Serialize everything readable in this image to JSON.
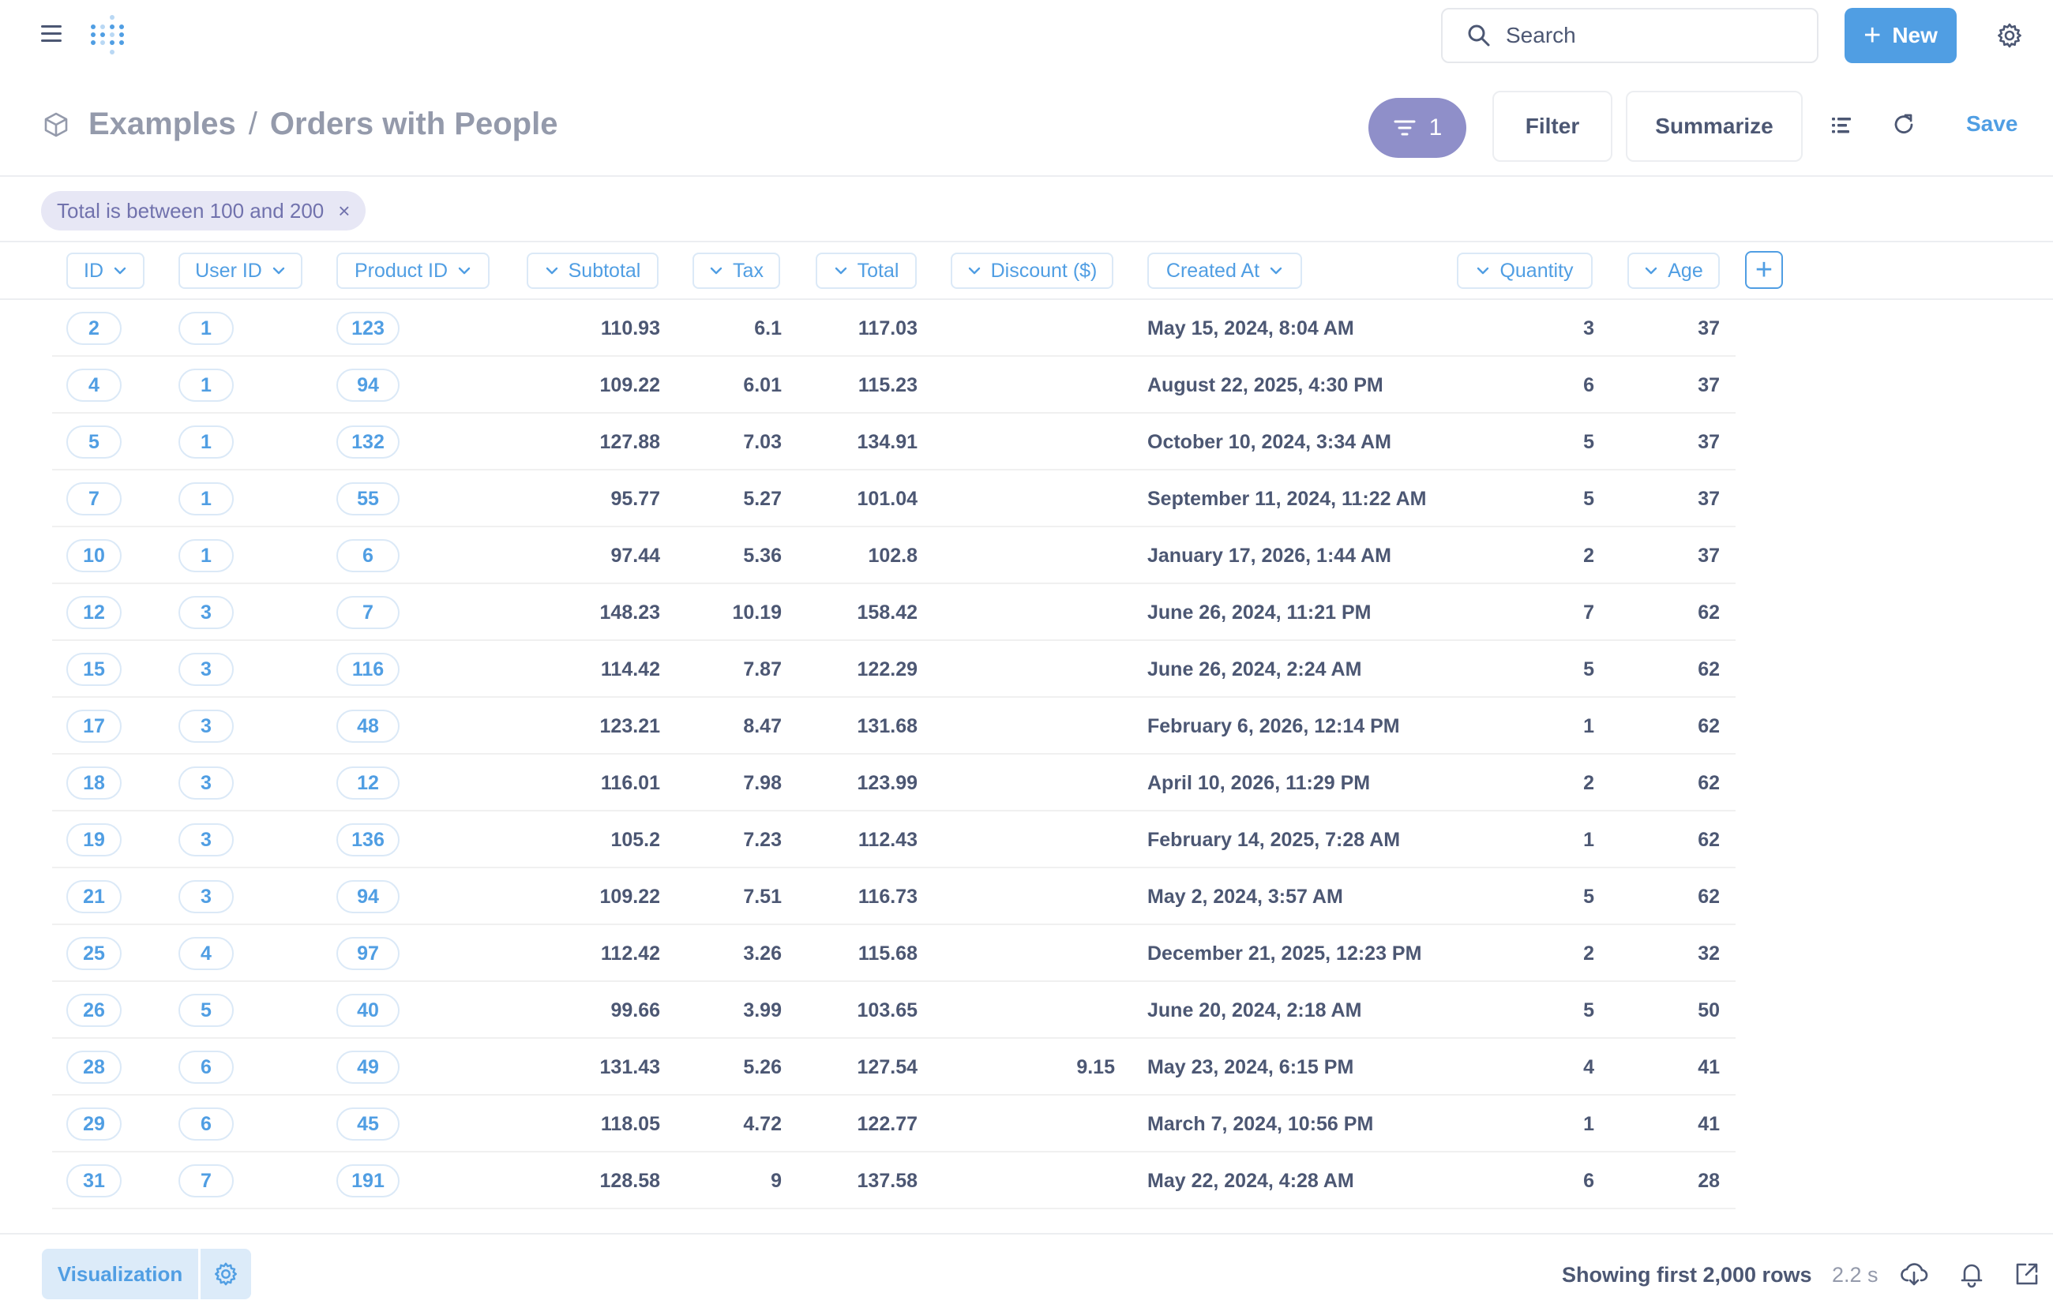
{
  "nav": {
    "search_placeholder": "Search",
    "new_label": "New",
    "new_plus": "+"
  },
  "header": {
    "collection": "Examples",
    "separator": "/",
    "title": "Orders with People",
    "filter_count": "1",
    "filter_label": "Filter",
    "summarize_label": "Summarize",
    "save_label": "Save"
  },
  "active_filter": {
    "label": "Total is between 100 and 200",
    "remove_glyph": "×"
  },
  "columns": [
    {
      "key": "id",
      "label": "ID"
    },
    {
      "key": "user_id",
      "label": "User ID"
    },
    {
      "key": "product_id",
      "label": "Product ID"
    },
    {
      "key": "subtotal",
      "label": "Subtotal"
    },
    {
      "key": "tax",
      "label": "Tax"
    },
    {
      "key": "total",
      "label": "Total"
    },
    {
      "key": "discount",
      "label": "Discount ($)"
    },
    {
      "key": "created_at",
      "label": "Created At"
    },
    {
      "key": "quantity",
      "label": "Quantity"
    },
    {
      "key": "age",
      "label": "Age"
    }
  ],
  "add_column_glyph": "+",
  "rows": [
    {
      "id": "2",
      "user_id": "1",
      "product_id": "123",
      "subtotal": "110.93",
      "tax": "6.1",
      "total": "117.03",
      "discount": "",
      "created_at": "May 15, 2024, 8:04 AM",
      "quantity": "3",
      "age": "37"
    },
    {
      "id": "4",
      "user_id": "1",
      "product_id": "94",
      "subtotal": "109.22",
      "tax": "6.01",
      "total": "115.23",
      "discount": "",
      "created_at": "August 22, 2025, 4:30 PM",
      "quantity": "6",
      "age": "37"
    },
    {
      "id": "5",
      "user_id": "1",
      "product_id": "132",
      "subtotal": "127.88",
      "tax": "7.03",
      "total": "134.91",
      "discount": "",
      "created_at": "October 10, 2024, 3:34 AM",
      "quantity": "5",
      "age": "37"
    },
    {
      "id": "7",
      "user_id": "1",
      "product_id": "55",
      "subtotal": "95.77",
      "tax": "5.27",
      "total": "101.04",
      "discount": "",
      "created_at": "September 11, 2024, 11:22 AM",
      "quantity": "5",
      "age": "37"
    },
    {
      "id": "10",
      "user_id": "1",
      "product_id": "6",
      "subtotal": "97.44",
      "tax": "5.36",
      "total": "102.8",
      "discount": "",
      "created_at": "January 17, 2026, 1:44 AM",
      "quantity": "2",
      "age": "37"
    },
    {
      "id": "12",
      "user_id": "3",
      "product_id": "7",
      "subtotal": "148.23",
      "tax": "10.19",
      "total": "158.42",
      "discount": "",
      "created_at": "June 26, 2024, 11:21 PM",
      "quantity": "7",
      "age": "62"
    },
    {
      "id": "15",
      "user_id": "3",
      "product_id": "116",
      "subtotal": "114.42",
      "tax": "7.87",
      "total": "122.29",
      "discount": "",
      "created_at": "June 26, 2024, 2:24 AM",
      "quantity": "5",
      "age": "62"
    },
    {
      "id": "17",
      "user_id": "3",
      "product_id": "48",
      "subtotal": "123.21",
      "tax": "8.47",
      "total": "131.68",
      "discount": "",
      "created_at": "February 6, 2026, 12:14 PM",
      "quantity": "1",
      "age": "62"
    },
    {
      "id": "18",
      "user_id": "3",
      "product_id": "12",
      "subtotal": "116.01",
      "tax": "7.98",
      "total": "123.99",
      "discount": "",
      "created_at": "April 10, 2026, 11:29 PM",
      "quantity": "2",
      "age": "62"
    },
    {
      "id": "19",
      "user_id": "3",
      "product_id": "136",
      "subtotal": "105.2",
      "tax": "7.23",
      "total": "112.43",
      "discount": "",
      "created_at": "February 14, 2025, 7:28 AM",
      "quantity": "1",
      "age": "62"
    },
    {
      "id": "21",
      "user_id": "3",
      "product_id": "94",
      "subtotal": "109.22",
      "tax": "7.51",
      "total": "116.73",
      "discount": "",
      "created_at": "May 2, 2024, 3:57 AM",
      "quantity": "5",
      "age": "62"
    },
    {
      "id": "25",
      "user_id": "4",
      "product_id": "97",
      "subtotal": "112.42",
      "tax": "3.26",
      "total": "115.68",
      "discount": "",
      "created_at": "December 21, 2025, 12:23 PM",
      "quantity": "2",
      "age": "32"
    },
    {
      "id": "26",
      "user_id": "5",
      "product_id": "40",
      "subtotal": "99.66",
      "tax": "3.99",
      "total": "103.65",
      "discount": "",
      "created_at": "June 20, 2024, 2:18 AM",
      "quantity": "5",
      "age": "50"
    },
    {
      "id": "28",
      "user_id": "6",
      "product_id": "49",
      "subtotal": "131.43",
      "tax": "5.26",
      "total": "127.54",
      "discount": "9.15",
      "created_at": "May 23, 2024, 6:15 PM",
      "quantity": "4",
      "age": "41"
    },
    {
      "id": "29",
      "user_id": "6",
      "product_id": "45",
      "subtotal": "118.05",
      "tax": "4.72",
      "total": "122.77",
      "discount": "",
      "created_at": "March 7, 2024, 10:56 PM",
      "quantity": "1",
      "age": "41"
    },
    {
      "id": "31",
      "user_id": "7",
      "product_id": "191",
      "subtotal": "128.58",
      "tax": "9",
      "total": "137.58",
      "discount": "",
      "created_at": "May 22, 2024, 4:28 AM",
      "quantity": "6",
      "age": "28"
    }
  ],
  "footer": {
    "visualization_label": "Visualization",
    "rows_label": "Showing first 2,000 rows",
    "duration": "2.2 s"
  },
  "colors": {
    "brand": "#509ee3",
    "filter_accent": "#8f8fc9",
    "text_dark": "#4c5773",
    "text_light": "#949aab"
  }
}
